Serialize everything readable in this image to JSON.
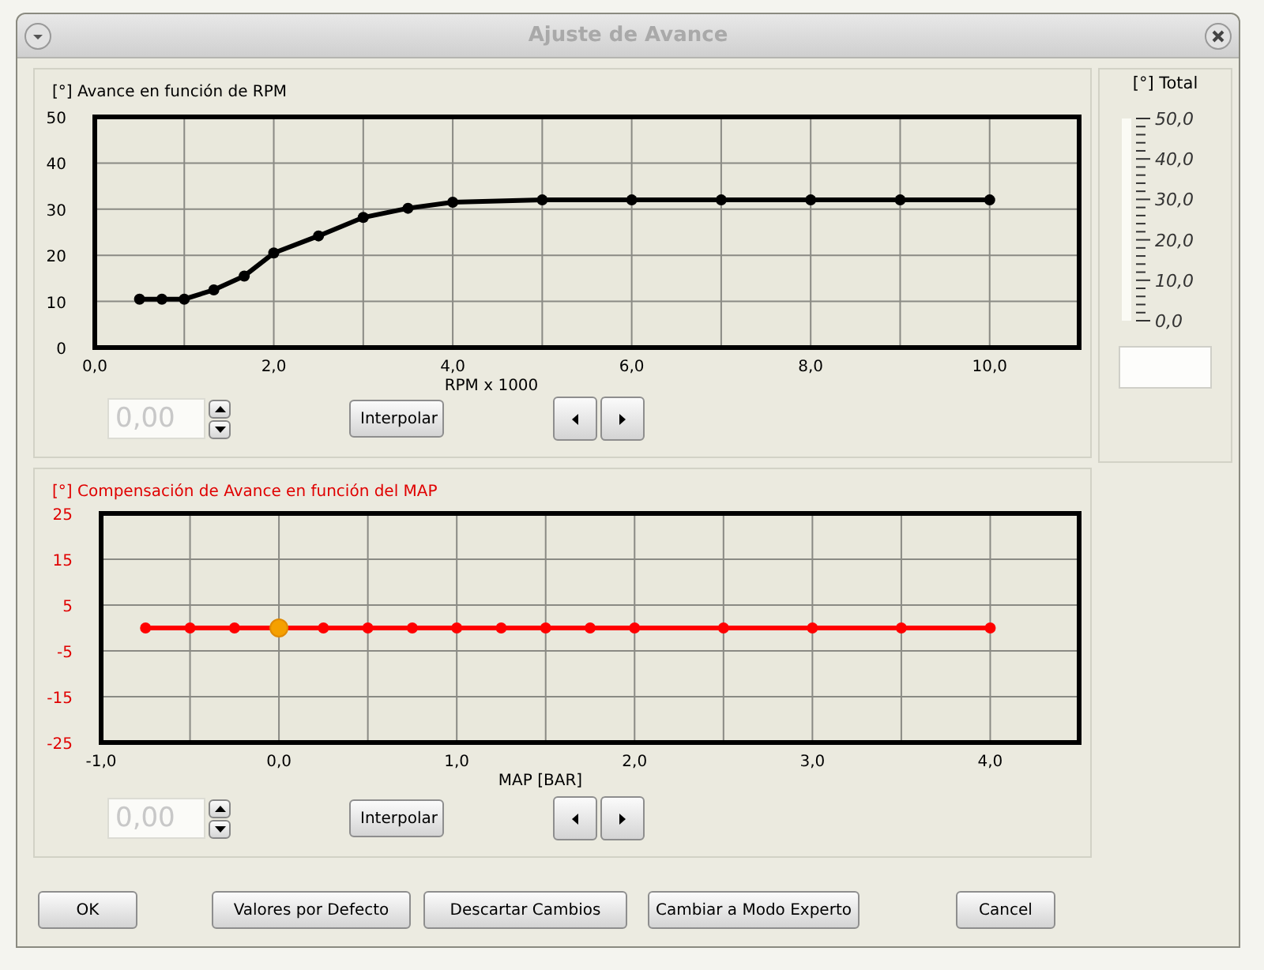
{
  "window": {
    "title": "Ajuste de Avance"
  },
  "rpm_panel": {
    "title": "[°] Avance en función de RPM",
    "chart_data": {
      "type": "line",
      "xlabel": "RPM x 1000",
      "xlim": [
        0,
        11
      ],
      "ylim": [
        0,
        50
      ],
      "xticks": [
        {
          "value": 0,
          "label": "0,0"
        },
        {
          "value": 2,
          "label": "2,0"
        },
        {
          "value": 4,
          "label": "4,0"
        },
        {
          "value": 6,
          "label": "6,0"
        },
        {
          "value": 8,
          "label": "8,0"
        },
        {
          "value": 10,
          "label": "10,0"
        }
      ],
      "yticks": [
        0,
        10,
        20,
        30,
        40,
        50
      ],
      "x": [
        0.5,
        0.75,
        1.0,
        1.33,
        1.67,
        2.0,
        2.5,
        3.0,
        3.5,
        4.0,
        5,
        6,
        7,
        8,
        9,
        10
      ],
      "grid": true,
      "series": [
        {
          "color": "#000000",
          "marker": true,
          "values": [
            10.5,
            10.5,
            10.5,
            12.5,
            15.5,
            20.5,
            24.2,
            28.2,
            30.2,
            31.5,
            32,
            32,
            32,
            32,
            32,
            32
          ]
        }
      ]
    },
    "value_field": {
      "value": "0,00",
      "disabled": true
    },
    "interpolate_button": "Interpolar"
  },
  "map_panel": {
    "title": "[°] Compensación de Avance en función del MAP",
    "chart_data": {
      "type": "line",
      "xlabel": "MAP [BAR]",
      "xlim": [
        -1,
        4.5
      ],
      "ylim": [
        -25,
        25
      ],
      "xticks": [
        {
          "value": -1,
          "label": "-1,0"
        },
        {
          "value": 0,
          "label": "0,0"
        },
        {
          "value": 1,
          "label": "1,0"
        },
        {
          "value": 2,
          "label": "2,0"
        },
        {
          "value": 3,
          "label": "3,0"
        },
        {
          "value": 4,
          "label": "4,0"
        }
      ],
      "yticks": [
        -25,
        -15,
        -5,
        5,
        15,
        25
      ],
      "x": [
        -0.75,
        -0.5,
        -0.25,
        0,
        0.25,
        0.5,
        0.75,
        1.0,
        1.25,
        1.5,
        1.75,
        2.0,
        2.5,
        3.0,
        3.5,
        4.0
      ],
      "grid": true,
      "series": [
        {
          "color": "#ff0000",
          "marker": true,
          "values": [
            0,
            0,
            0,
            0,
            0,
            0,
            0,
            0,
            0,
            0,
            0,
            0,
            0,
            0,
            0,
            0
          ]
        }
      ]
    },
    "points": [
      {
        "selected": false
      },
      {
        "selected": false
      },
      {
        "selected": false
      },
      {
        "selected": true
      },
      {
        "selected": false
      },
      {
        "selected": false
      },
      {
        "selected": false
      },
      {
        "selected": false
      },
      {
        "selected": false
      },
      {
        "selected": false
      },
      {
        "selected": false
      },
      {
        "selected": false
      },
      {
        "selected": false
      },
      {
        "selected": false
      },
      {
        "selected": false
      },
      {
        "selected": false
      }
    ],
    "value_field": {
      "value": "0,00",
      "disabled": true
    },
    "interpolate_button": "Interpolar"
  },
  "total_panel": {
    "title": "[°] Total",
    "scale_labels": [
      "50,0",
      "40,0",
      "30,0",
      "20,0",
      "10,0",
      "0,0"
    ]
  },
  "buttons": [
    "OK",
    "Valores por Defecto",
    "Descartar Cambios",
    "Cambiar a Modo Experto",
    "Cancel"
  ]
}
